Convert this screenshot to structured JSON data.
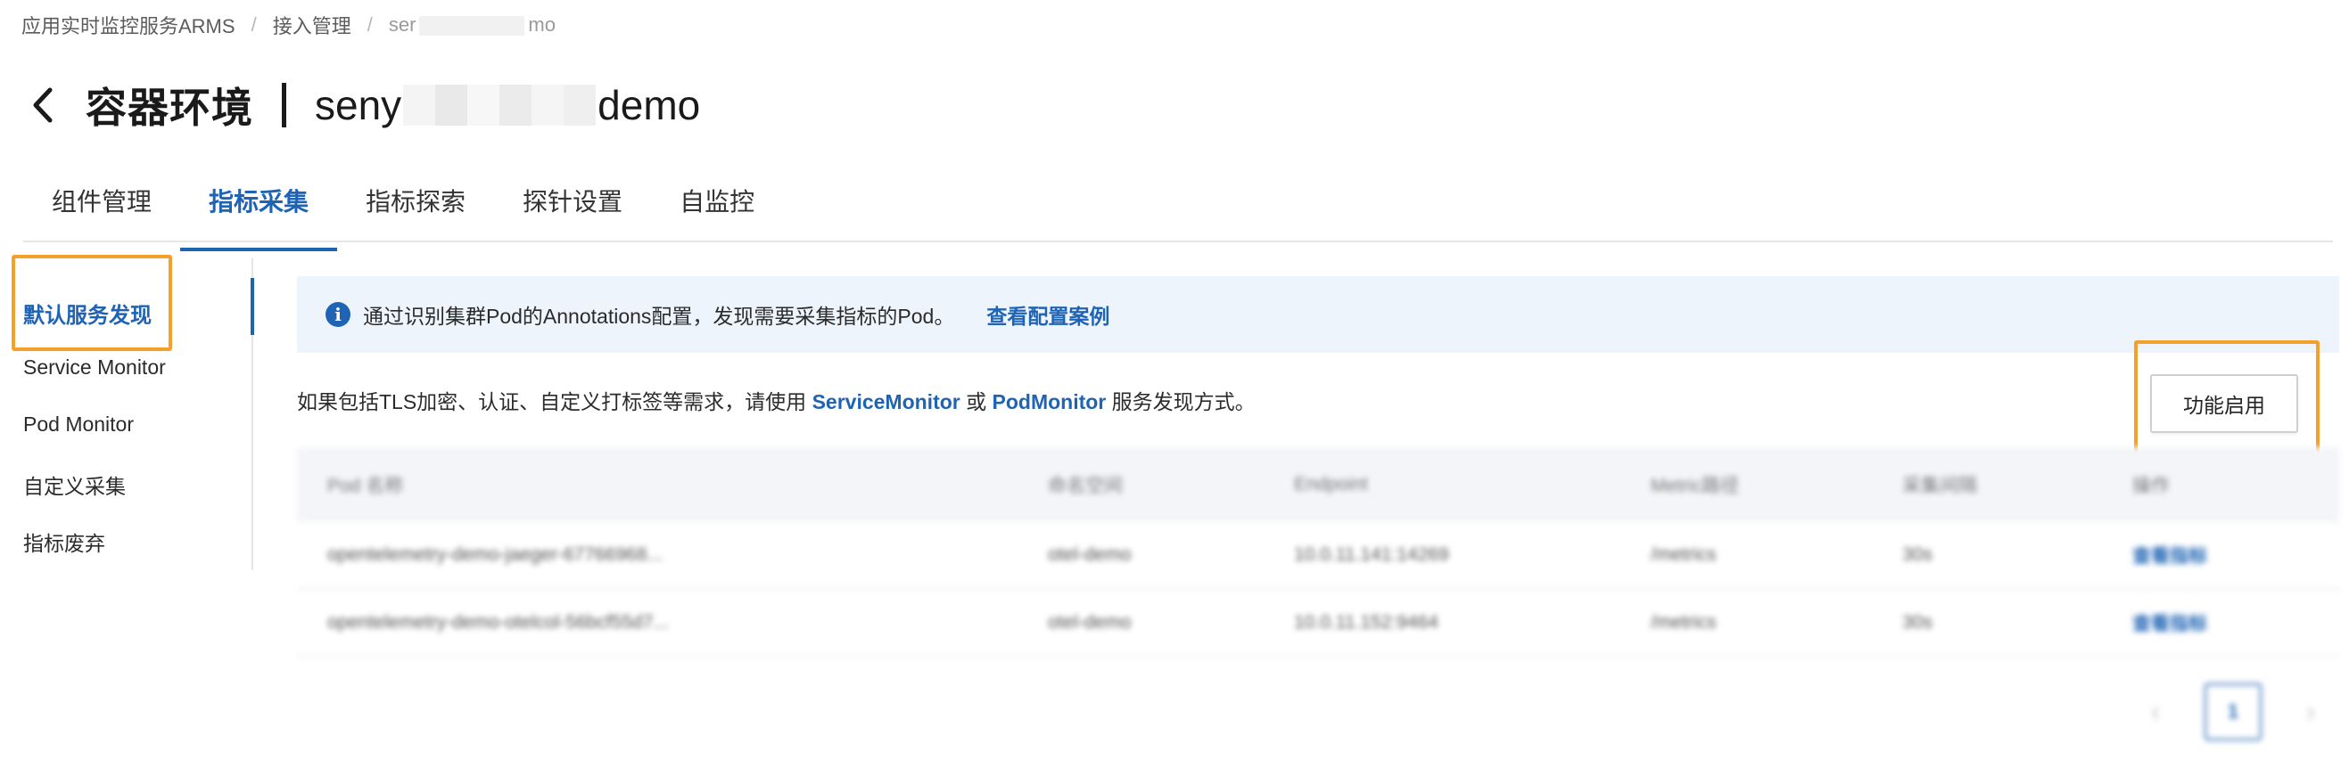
{
  "breadcrumb": {
    "items": [
      "应用实时监控服务ARMS",
      "接入管理"
    ],
    "current_prefix": "ser",
    "current_suffix": "mo"
  },
  "header": {
    "back_icon": "chevron-left-icon",
    "title": "容器环境",
    "instance_prefix": "seny",
    "instance_suffix": "demo"
  },
  "tabs": [
    {
      "label": "组件管理",
      "active": false
    },
    {
      "label": "指标采集",
      "active": true
    },
    {
      "label": "指标探索",
      "active": false
    },
    {
      "label": "探针设置",
      "active": false
    },
    {
      "label": "自监控",
      "active": false
    }
  ],
  "sidenav": {
    "items": [
      "默认服务发现",
      "Service Monitor",
      "Pod Monitor",
      "自定义采集",
      "指标废弃"
    ],
    "active_index": 0
  },
  "alert": {
    "icon": "info-icon",
    "text": "通过识别集群Pod的Annotations配置，发现需要采集指标的Pod。",
    "link": "查看配置案例"
  },
  "notice": {
    "before": "如果包括TLS加密、认证、自定义打标签等需求，请使用 ",
    "link1": "ServiceMonitor",
    "middle": " 或 ",
    "link2": "PodMonitor",
    "after": " 服务发现方式。"
  },
  "enable_button": "功能启用",
  "table": {
    "columns": [
      "Pod 名称",
      "命名空间",
      "Endpoint",
      "Metric路径",
      "采集间隔",
      "操作"
    ],
    "rows": [
      [
        "opentelemetry-demo-jaeger-67766968...",
        "otel-demo",
        "10.0.11.141:14269",
        "/metrics",
        "30s",
        "查看指标"
      ],
      [
        "opentelemetry-demo-otelcol-56bcf55d7...",
        "otel-demo",
        "10.0.11.152:9464",
        "/metrics",
        "30s",
        "查看指标"
      ]
    ]
  },
  "pagination": {
    "current": "1",
    "prev_icon": "chevron-left-icon",
    "next_icon": "chevron-right-icon"
  },
  "colors": {
    "primary": "#1f64b4",
    "highlight": "#f5a02a",
    "alert_bg": "#eef4fc"
  }
}
